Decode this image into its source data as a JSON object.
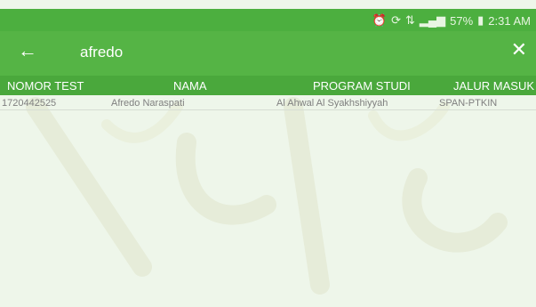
{
  "status_bar": {
    "battery": "57%",
    "time": "2:31 AM"
  },
  "search": {
    "query": "afredo"
  },
  "table": {
    "columns": [
      "NOMOR TEST",
      "NAMA",
      "PROGRAM STUDI",
      "JALUR MASUK"
    ],
    "rows": [
      [
        "1720442525",
        "Afredo Naraspati",
        "Al Ahwal Al Syakhshiyyah",
        "SPAN-PTKIN"
      ]
    ]
  },
  "colors": {
    "primary": "#55b445",
    "status": "#4caf3f",
    "header": "#4aa83c",
    "background": "#eef6ea"
  },
  "icons": [
    "alarm-icon",
    "sync-icon",
    "data-icon",
    "signal-icon",
    "battery-icon",
    "back-arrow-icon",
    "close-icon"
  ]
}
